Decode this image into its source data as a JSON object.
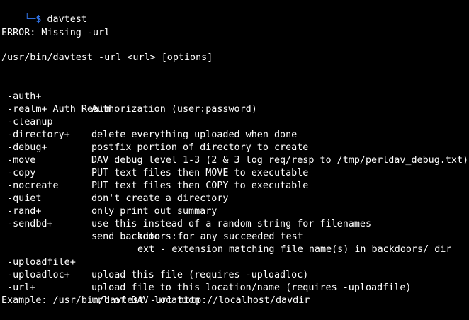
{
  "prompt": {
    "corner": "└─",
    "dollar": "$",
    "command": "davtest"
  },
  "error": "ERROR: Missing -url",
  "usage": "/usr/bin/davtest -url <url> [options]",
  "options": [
    {
      "flag": " -auth+",
      "desc": "Authorization (user:password)"
    },
    {
      "flag": " -realm+ Auth Realm",
      "desc": ""
    },
    {
      "flag": " -cleanup",
      "desc": "delete everything uploaded when done"
    },
    {
      "flag": " -directory+",
      "desc": "postfix portion of directory to create"
    },
    {
      "flag": " -debug+",
      "desc": "DAV debug level 1-3 (2 & 3 log req/resp to /tmp/perldav_debug.txt)"
    },
    {
      "flag": " -move",
      "desc": "PUT text files then MOVE to executable"
    },
    {
      "flag": " -copy",
      "desc": "PUT text files then COPY to executable"
    },
    {
      "flag": " -nocreate",
      "desc": "don't create a directory"
    },
    {
      "flag": " -quiet",
      "desc": "only print out summary"
    },
    {
      "flag": " -rand+",
      "desc": "use this instead of a random string for filenames"
    },
    {
      "flag": " -sendbd+",
      "desc": "send backdoors:"
    }
  ],
  "sendbd_sub": [
    "auto - for any succeeded test",
    "ext - extension matching file name(s) in backdoors/ dir"
  ],
  "options_tail": [
    {
      "flag": " -uploadfile+",
      "desc": "upload this file (requires -uploadloc)"
    },
    {
      "flag": " -uploadloc+",
      "desc": "upload file to this location/name (requires -uploadfile)"
    },
    {
      "flag": " -url+",
      "desc": "url of DAV location"
    }
  ],
  "example": "Example: /usr/bin/davtest -url http://localhost/davdir",
  "colors": {
    "background": "#000000",
    "text": "#ffffff",
    "prompt": "#2f6fde"
  }
}
